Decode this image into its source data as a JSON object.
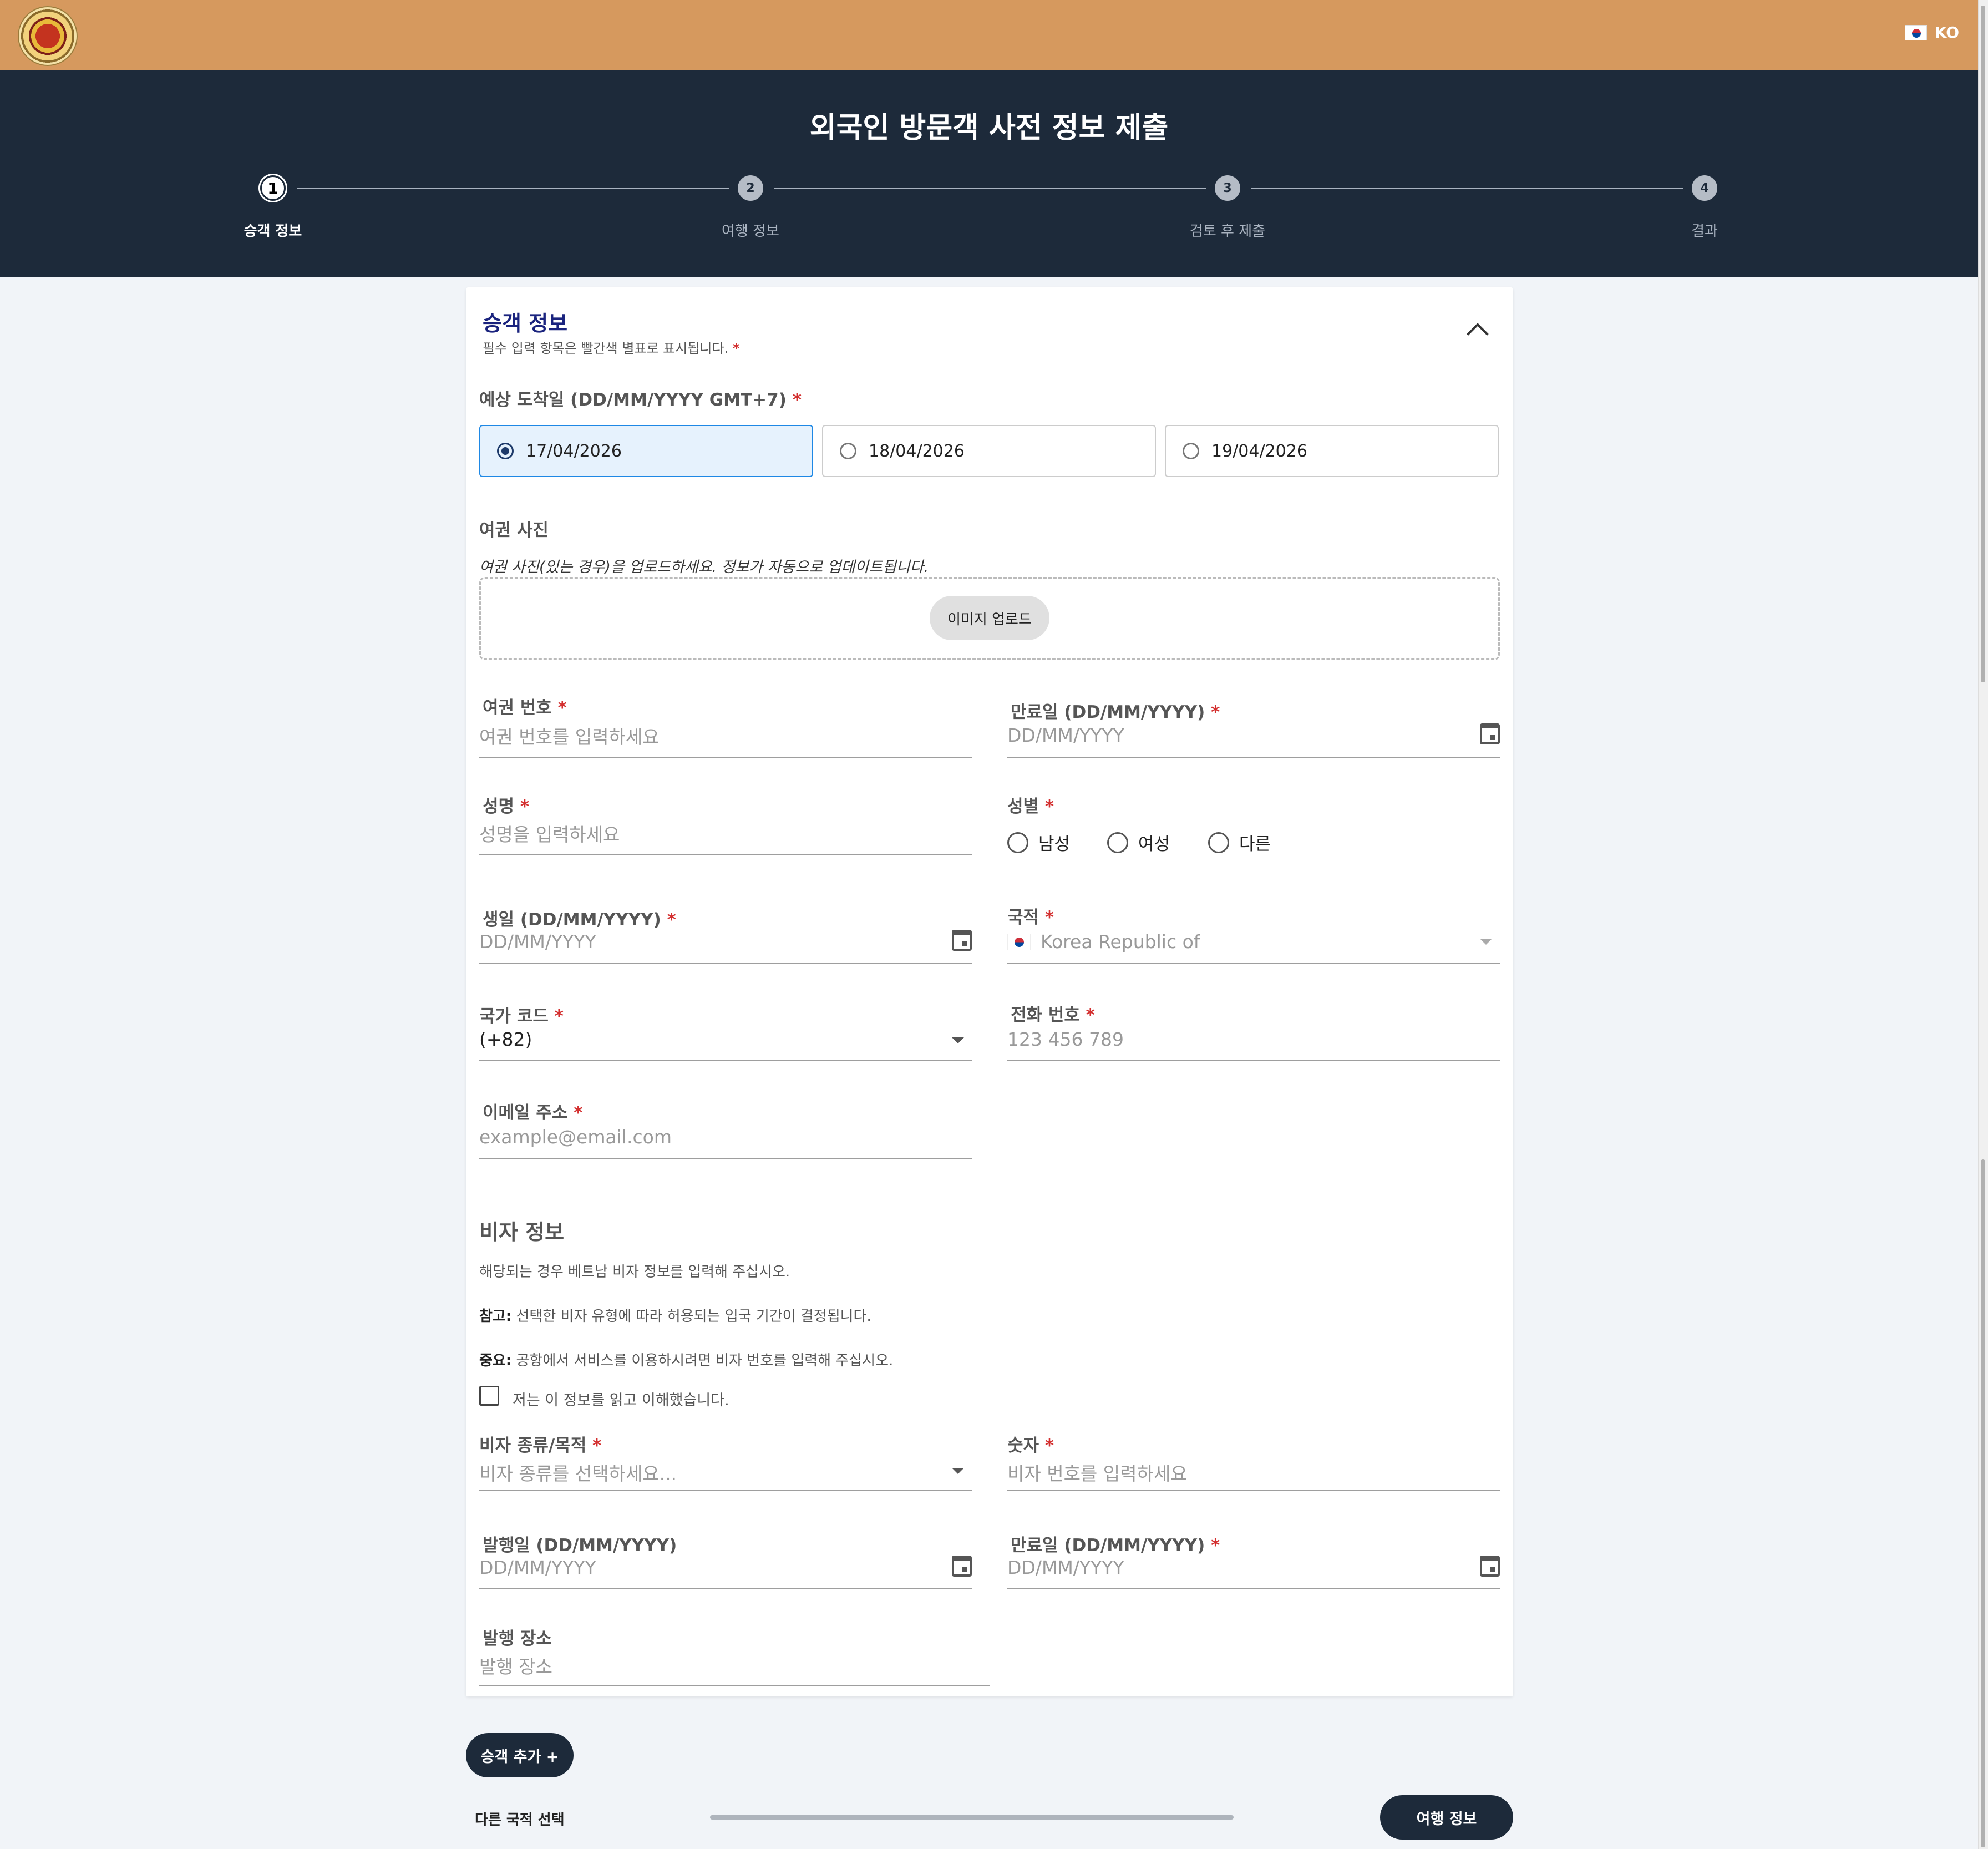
{
  "header": {
    "lang_code": "KO",
    "lang_flag_icon": "korea-flag-icon",
    "title": "외국인 방문객 사전 정보 제출",
    "colors": {
      "topbar": "#d6995e",
      "band": "#1d2a3a"
    }
  },
  "steps": [
    {
      "num": "1",
      "label": "승객 정보"
    },
    {
      "num": "2",
      "label": "여행 정보"
    },
    {
      "num": "3",
      "label": "검토 후 제출"
    },
    {
      "num": "4",
      "label": "결과"
    }
  ],
  "passenger": {
    "title": "승객 정보",
    "subtitle": "필수 입력 항목은 빨간색 별표로 표시됩니다.",
    "arrival_label": "예상 도착일 (DD/MM/YYYY GMT+7)",
    "arrival_options": [
      "17/04/2026",
      "18/04/2026",
      "19/04/2026"
    ],
    "arrival_selected": "17/04/2026",
    "passport_photo_label": "여권 사진",
    "passport_photo_hint": "여권 사진(있는 경우)을 업로드하세요. 정보가 자동으로 업데이트됩니다.",
    "upload_button": "이미지 업로드",
    "passport_no_label": "여권 번호",
    "passport_no_placeholder": "여권 번호를 입력하세요",
    "expiry_label": "만료일 (DD/MM/YYYY)",
    "expiry_placeholder": "DD/MM/YYYY",
    "name_label": "성명",
    "name_placeholder": "성명을 입력하세요",
    "gender_label": "성별",
    "gender_options": [
      "남성",
      "여성",
      "다른"
    ],
    "dob_label": "생일 (DD/MM/YYYY)",
    "dob_placeholder": "DD/MM/YYYY",
    "nationality_label": "국적",
    "nationality_value": "Korea Republic of",
    "country_code_label": "국가 코드",
    "country_code_value": "(+82)",
    "phone_label": "전화 번호",
    "phone_placeholder": "123 456 789",
    "email_label": "이메일 주소",
    "email_placeholder": "example@email.com"
  },
  "visa": {
    "title": "비자 정보",
    "intro": "해당되는 경우 베트남 비자 정보를 입력해 주십시오.",
    "note_label": "참고:",
    "note_text": " 선택한 비자 유형에 따라 허용되는 입국 기간이 결정됩니다.",
    "important_label": "중요:",
    "important_text": " 공항에서 서비스를 이용하시려면 비자 번호를 입력해 주십시오.",
    "ack_label": "저는 이 정보를 읽고 이해했습니다.",
    "type_label": "비자 종류/목적",
    "type_placeholder": "비자 종류를 선택하세요...",
    "number_label": "숫자",
    "number_placeholder": "비자 번호를 입력하세요",
    "issue_label": "발행일 (DD/MM/YYYY)",
    "issue_placeholder": "DD/MM/YYYY",
    "expiry_label": "만료일 (DD/MM/YYYY)",
    "expiry_placeholder": "DD/MM/YYYY",
    "place_label": "발행 장소",
    "place_placeholder": "발행 장소"
  },
  "footer": {
    "add_passenger": "승객 추가 +",
    "other_nationality": "다른 국적 선택",
    "next_button": "여행 정보"
  }
}
